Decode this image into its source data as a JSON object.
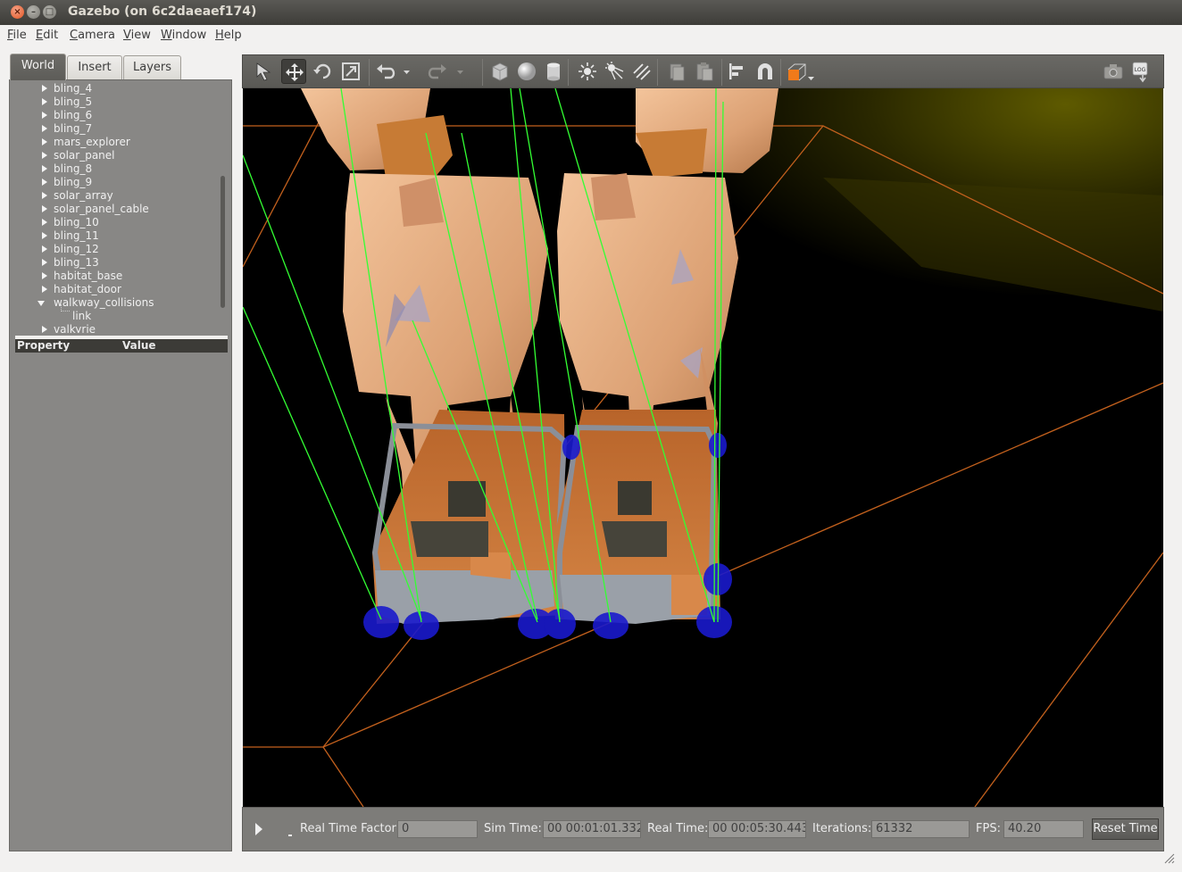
{
  "window": {
    "title": "Gazebo (on 6c2daeaef174)",
    "close_glyph": "×",
    "min_glyph": "–",
    "max_glyph": "□"
  },
  "menu": [
    "File",
    "Edit",
    "Camera",
    "View",
    "Window",
    "Help"
  ],
  "tabs": [
    "World",
    "Insert",
    "Layers"
  ],
  "tree": [
    {
      "label": "bling_4",
      "expanded": false
    },
    {
      "label": "bling_5",
      "expanded": false
    },
    {
      "label": "bling_6",
      "expanded": false
    },
    {
      "label": "bling_7",
      "expanded": false
    },
    {
      "label": "mars_explorer",
      "expanded": false
    },
    {
      "label": "solar_panel",
      "expanded": false
    },
    {
      "label": "bling_8",
      "expanded": false
    },
    {
      "label": "bling_9",
      "expanded": false
    },
    {
      "label": "solar_array",
      "expanded": false
    },
    {
      "label": "solar_panel_cable",
      "expanded": false
    },
    {
      "label": "bling_10",
      "expanded": false
    },
    {
      "label": "bling_11",
      "expanded": false
    },
    {
      "label": "bling_12",
      "expanded": false
    },
    {
      "label": "bling_13",
      "expanded": false
    },
    {
      "label": "habitat_base",
      "expanded": false
    },
    {
      "label": "habitat_door",
      "expanded": false
    },
    {
      "label": "walkway_collisions",
      "expanded": true
    },
    {
      "label": "link",
      "child": true
    },
    {
      "label": "valkyrie",
      "expanded": false
    }
  ],
  "properties": {
    "col_property": "Property",
    "col_value": "Value"
  },
  "toolbar": {
    "left": [
      "select-arrow-icon",
      "translate-icon",
      "rotate-icon",
      "scale-icon",
      "undo-icon",
      "undo-history-icon",
      "redo-icon",
      "redo-history-icon",
      "box-icon",
      "sphere-icon",
      "cylinder-icon",
      "point-light-icon",
      "spot-light-icon",
      "directional-light-icon",
      "copy-icon",
      "paste-icon",
      "align-icon",
      "snap-icon",
      "view-angle-icon"
    ],
    "right": [
      "screenshot-icon",
      "log-icon"
    ],
    "log_text": "LOG"
  },
  "status": {
    "real_time_factor_label": "Real Time Factor:",
    "real_time_factor": "0",
    "sim_time_label": "Sim Time:",
    "sim_time": "00 00:01:01.332",
    "real_time_label": "Real Time:",
    "real_time": "00 00:05:30.443",
    "iterations_label": "Iterations:",
    "iterations": "61332",
    "fps_label": "FPS:",
    "fps": "40.20",
    "reset_label": "Reset Time"
  },
  "colors": {
    "accent_orange": "#e8782a",
    "selection_blue": "#1a1acc",
    "contact_green": "#33ff33",
    "robot_skin": "#e0a878"
  }
}
